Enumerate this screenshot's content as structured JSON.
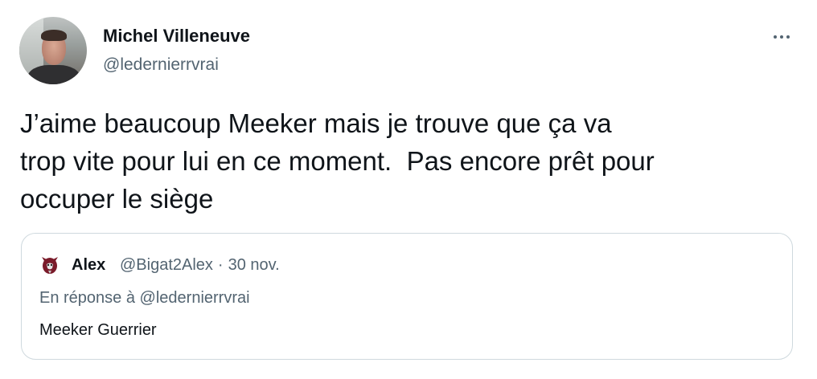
{
  "author": {
    "display_name": "Michel Villeneuve",
    "handle": "@ledernierrvrai"
  },
  "tweet": {
    "text": "J’aime beaucoup Meeker mais je trouve que ça va\ntrop vite pour lui en ce moment.  Pas encore prêt pour\noccuper le siège"
  },
  "quote": {
    "display_name": "Alex",
    "handle": "@Bigat2Alex",
    "separator": "·",
    "date": "30 nov.",
    "reply_prefix": "En réponse à",
    "reply_to": "@ledernierrvrai",
    "text": "Meeker Guerrier"
  },
  "icons": {
    "more": "more-options-icon",
    "quote_avatar": "team-logo-icon"
  },
  "colors": {
    "text": "#0f1419",
    "secondary": "#536471",
    "border": "#cfd9de"
  }
}
